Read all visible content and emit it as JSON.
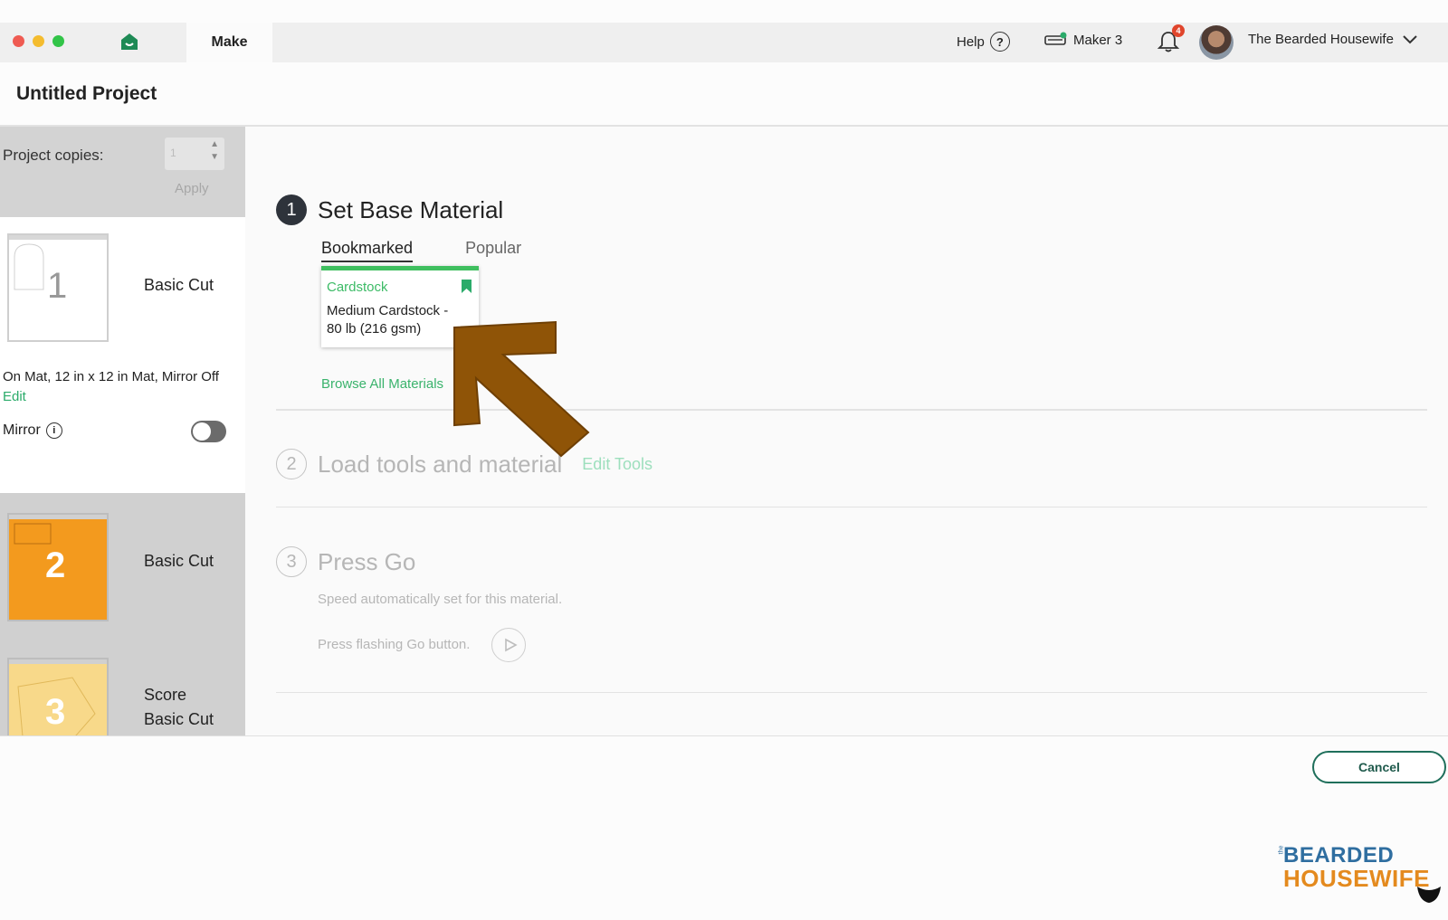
{
  "topbar": {
    "tab_make": "Make",
    "help_label": "Help",
    "help_symbol": "?",
    "machine_label": "Maker 3",
    "notification_count": "4",
    "user_name": "The Bearded Housewife",
    "colors": {
      "close": "#ef5b52",
      "minimize": "#f4bc2f",
      "maximize": "#32c448",
      "brand_green": "#2bab6a"
    }
  },
  "project": {
    "title": "Untitled Project"
  },
  "sidebar": {
    "copies_label": "Project copies:",
    "copies_value": "1",
    "apply_label": "Apply",
    "mats": [
      {
        "number": "1",
        "label": "Basic Cut",
        "color": "#ffffff"
      },
      {
        "number": "2",
        "label": "Basic Cut",
        "color": "#f39a1e"
      },
      {
        "number": "3",
        "label_line1": "Score",
        "label_line2": "Basic Cut",
        "color": "#f8d98a"
      }
    ],
    "mat_info": "On Mat, 12 in x 12 in Mat, Mirror Off",
    "edit_label": "Edit",
    "mirror_label": "Mirror",
    "mirror_on": false
  },
  "steps": {
    "step1": {
      "number": "1",
      "title": "Set Base Material",
      "tabs": [
        "Bookmarked",
        "Popular"
      ],
      "card": {
        "category": "Cardstock",
        "line1": "Medium Cardstock -",
        "line2": "80 lb (216 gsm)"
      },
      "browse_label": "Browse All Materials"
    },
    "step2": {
      "number": "2",
      "title": "Load tools and material",
      "edit_tools_label": "Edit Tools"
    },
    "step3": {
      "number": "3",
      "title": "Press Go",
      "speed_text": "Speed automatically set for this material.",
      "press_text": "Press flashing Go button."
    }
  },
  "footer": {
    "cancel_label": "Cancel"
  },
  "watermark": {
    "the": "the",
    "line1": "BEARDED",
    "line2": "HOUSEWIFE"
  }
}
